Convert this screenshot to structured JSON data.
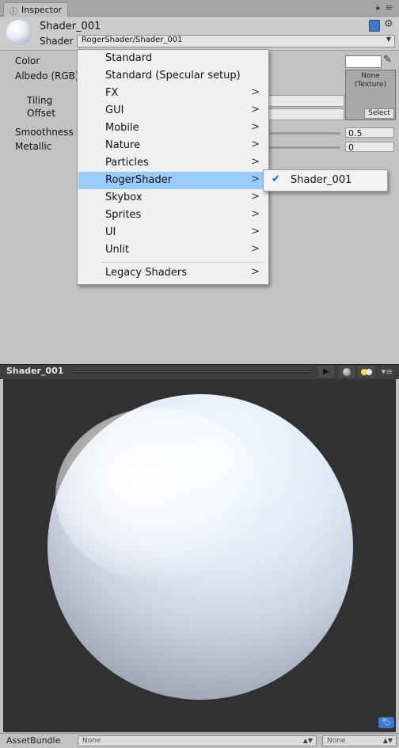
{
  "tab": {
    "label": "Inspector",
    "info_icon": "info-icon",
    "lock_icon": "lock-icon",
    "menu_icon": "tab-menu-icon"
  },
  "header": {
    "material_name": "Shader_001",
    "shader_label": "Shader",
    "shader_value": "RogerShader/Shader_001",
    "icons": [
      "material-sphere-icon",
      "book-icon",
      "gear-icon"
    ]
  },
  "properties": {
    "color_label": "Color",
    "albedo_label": "Albedo (RGB)",
    "tiling_label": "Tiling",
    "offset_label": "Offset",
    "smoothness_label": "Smoothness",
    "smoothness_value": "0.5",
    "metallic_label": "Metallic",
    "metallic_value": "0",
    "color_swatch": "#ffffff",
    "texture_none": "None",
    "texture_type": "(Texture)",
    "texture_select": "Select"
  },
  "menu": {
    "items": [
      {
        "label": "Standard",
        "has_submenu": false
      },
      {
        "label": "Standard (Specular setup)",
        "has_submenu": false
      },
      {
        "label": "FX",
        "has_submenu": true
      },
      {
        "label": "GUI",
        "has_submenu": true
      },
      {
        "label": "Mobile",
        "has_submenu": true
      },
      {
        "label": "Nature",
        "has_submenu": true
      },
      {
        "label": "Particles",
        "has_submenu": true
      },
      {
        "label": "RogerShader",
        "has_submenu": true,
        "highlighted": true
      },
      {
        "label": "Skybox",
        "has_submenu": true
      },
      {
        "label": "Sprites",
        "has_submenu": true
      },
      {
        "label": "UI",
        "has_submenu": true
      },
      {
        "label": "Unlit",
        "has_submenu": true
      },
      {
        "label": "Legacy Shaders",
        "has_submenu": true
      }
    ],
    "arrow": ">",
    "highlight_color": "#99ccf8"
  },
  "submenu": {
    "checkmark": "✔",
    "label": "Shader_001"
  },
  "preview": {
    "title": "Shader_001",
    "play_icon": "play-icon",
    "sphere_icon": "sphere-icon",
    "light_icon": "light-icon",
    "menu": "▾≡",
    "tag_icon": "tag-icon"
  },
  "assetbundle": {
    "label": "AssetBundle",
    "bundle_value": "None",
    "variant_value": "None"
  }
}
